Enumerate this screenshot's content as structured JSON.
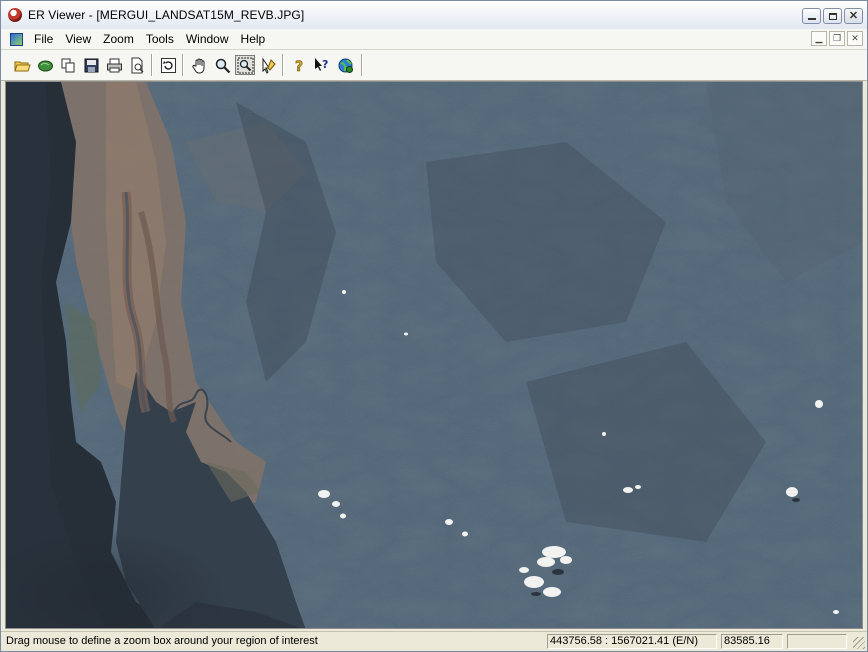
{
  "window": {
    "title": "ER Viewer - [MERGUI_LANDSAT15M_REVB.JPG]"
  },
  "menu": {
    "items": [
      "File",
      "View",
      "Zoom",
      "Tools",
      "Window",
      "Help"
    ]
  },
  "toolbar": {
    "buttons": [
      {
        "name": "open-icon",
        "pressed": false
      },
      {
        "name": "globe-open-icon",
        "pressed": false
      },
      {
        "name": "copy-icon",
        "pressed": false
      },
      {
        "name": "save-icon",
        "pressed": false
      },
      {
        "name": "print-icon",
        "pressed": false
      },
      {
        "name": "print-preview-icon",
        "pressed": false
      },
      {
        "name": "refresh-icon",
        "pressed": false
      },
      {
        "name": "pan-hand-icon",
        "pressed": false
      },
      {
        "name": "zoom-icon",
        "pressed": false
      },
      {
        "name": "zoom-box-icon",
        "pressed": true
      },
      {
        "name": "pointer-edit-icon",
        "pressed": false
      },
      {
        "name": "help-icon",
        "pressed": false
      },
      {
        "name": "context-help-icon",
        "pressed": false
      },
      {
        "name": "web-globe-icon",
        "pressed": false
      }
    ]
  },
  "viewer": {
    "image_name": "MERGUI_LANDSAT15M_REVB.JPG",
    "content": "Landsat satellite image"
  },
  "status": {
    "message": "Drag mouse to define a zoom box around your region of interest",
    "coordinates": "443756.58 : 1567021.41 (E/N)",
    "value": "83585.16",
    "extra": ""
  },
  "colors": {
    "land_base": "#4c5866",
    "coastal_plain": "#8a7466",
    "sea": "#262e38",
    "estuary": "#34404c",
    "cloud": "#f2f2f0"
  }
}
